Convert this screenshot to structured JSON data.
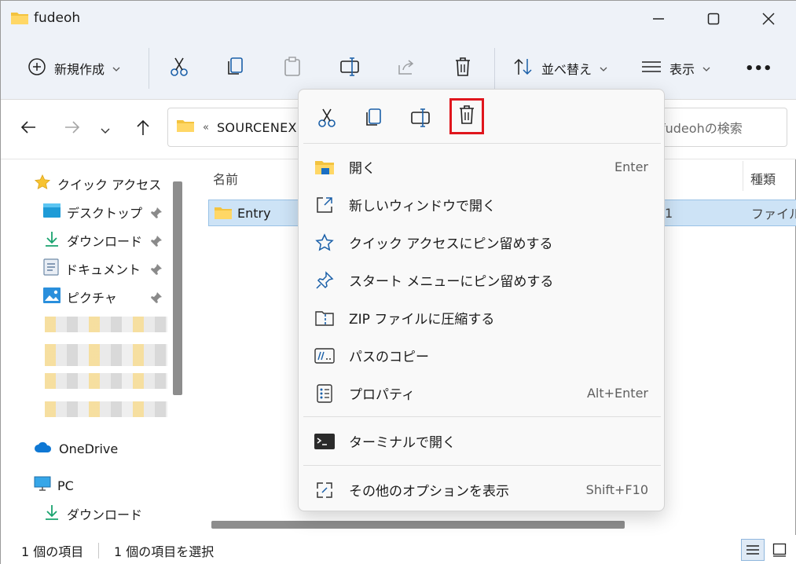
{
  "window": {
    "title": "fudeoh"
  },
  "toolbar": {
    "new_label": "新規作成",
    "sort_label": "並べ替え",
    "view_label": "表示",
    "more_label": "•••"
  },
  "address": {
    "crumb_prefix": "«",
    "crumb": "SOURCENEX",
    "search_placeholder": "fudeohの検索"
  },
  "sidebar": {
    "quick_access": "クイック アクセス",
    "items": [
      {
        "label": "デスクトップ"
      },
      {
        "label": "ダウンロード"
      },
      {
        "label": "ドキュメント"
      },
      {
        "label": "ピクチャ"
      }
    ],
    "onedrive": "OneDrive",
    "pc": "PC",
    "pc_items": [
      {
        "label": "ダウンロード"
      }
    ]
  },
  "content": {
    "columns": {
      "name": "名前",
      "type": "種類"
    },
    "rows": [
      {
        "name": "Entry",
        "date_fragment": "1",
        "type": "ファイル フ"
      }
    ]
  },
  "status": {
    "count": "1 個の項目",
    "selected": "1 個の項目を選択"
  },
  "context_menu": {
    "items": [
      {
        "label": "開く",
        "shortcut": "Enter"
      },
      {
        "label": "新しいウィンドウで開く",
        "shortcut": ""
      },
      {
        "label": "クイック アクセスにピン留めする",
        "shortcut": ""
      },
      {
        "label": "スタート メニューにピン留めする",
        "shortcut": ""
      },
      {
        "label": "ZIP ファイルに圧縮する",
        "shortcut": ""
      },
      {
        "label": "パスのコピー",
        "shortcut": ""
      },
      {
        "label": "プロパティ",
        "shortcut": "Alt+Enter"
      }
    ],
    "terminal": {
      "label": "ターミナルで開く"
    },
    "more": {
      "label": "その他のオプションを表示",
      "shortcut": "Shift+F10"
    }
  },
  "colors": {
    "accent": "#0067c0",
    "highlight_box": "#e0161d",
    "selection": "#cde3f6"
  }
}
